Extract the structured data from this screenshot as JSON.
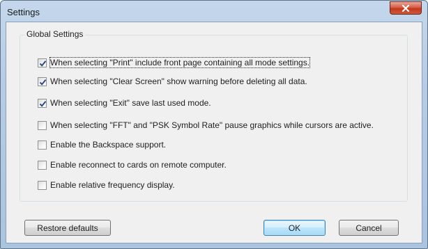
{
  "window": {
    "title": "Settings"
  },
  "group": {
    "title": "Global Settings"
  },
  "options": [
    {
      "label": "When selecting \"Print\" include front page containing all mode settings.",
      "checked": true
    },
    {
      "label": "When selecting \"Clear Screen\" show warning before deleting all data.",
      "checked": true
    },
    {
      "label": "When selecting \"Exit\" save last used mode.",
      "checked": true
    },
    {
      "label": "When selecting \"FFT\" and \"PSK Symbol Rate\" pause graphics while cursors are active.",
      "checked": false
    },
    {
      "label": "Enable the Backspace support.",
      "checked": false
    },
    {
      "label": "Enable reconnect to cards on remote computer.",
      "checked": false
    },
    {
      "label": "Enable relative frequency display.",
      "checked": false
    }
  ],
  "buttons": {
    "restore": "Restore defaults",
    "ok": "OK",
    "cancel": "Cancel"
  },
  "icons": {
    "close": "close-icon",
    "check": "checkmark-icon"
  },
  "colors": {
    "close_button": "#c83a1f",
    "check_mark": "#2b4a8a",
    "client_background": "#f0f0f0"
  }
}
